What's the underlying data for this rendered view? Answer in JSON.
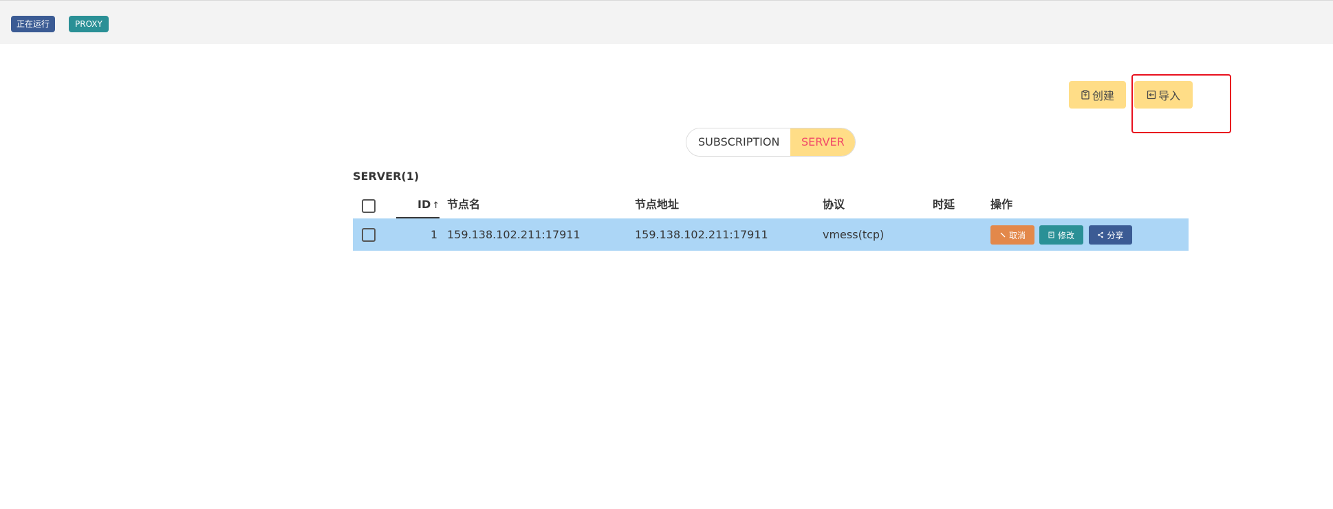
{
  "status": {
    "running_label": "正在运行",
    "mode_label": "PROXY"
  },
  "actions": {
    "create_label": "创建",
    "import_label": "导入"
  },
  "tabs": {
    "subscription_label": "SUBSCRIPTION",
    "server_label": "SERVER",
    "active": "SERVER"
  },
  "section": {
    "title": "SERVER(1)"
  },
  "table": {
    "columns": {
      "id": "ID",
      "sort_indicator": "↑",
      "name": "节点名",
      "address": "节点地址",
      "protocol": "协议",
      "latency": "时延",
      "operations": "操作"
    },
    "rows": [
      {
        "id": "1",
        "name": "159.138.102.211:17911",
        "address": "159.138.102.211:17911",
        "protocol": "vmess(tcp)",
        "latency": "",
        "selected": true,
        "cancel_label": "取消",
        "edit_label": "修改",
        "share_label": "分享"
      }
    ]
  },
  "colors": {
    "accent_yellow": "#ffdd87",
    "selected_row": "#acd6f6",
    "tag_blue": "#3b5b94",
    "tag_teal": "#2a9096",
    "cancel_orange": "#e3884a",
    "highlight_red": "#e8101e"
  }
}
